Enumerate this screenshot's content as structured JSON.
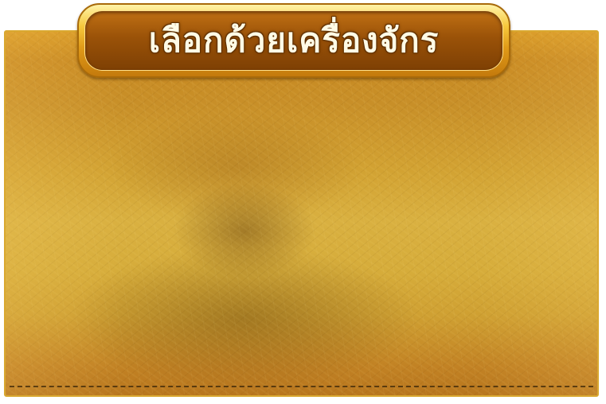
{
  "dialog": {
    "title": "เลือกด้วยเครื่องจักร"
  },
  "colors": {
    "panel_leather": "#d2a232",
    "panel_border": "#d9a830",
    "banner_gold": "#f6c83c",
    "banner_inner": "#9a5208",
    "title_text": "#fffbe6"
  }
}
